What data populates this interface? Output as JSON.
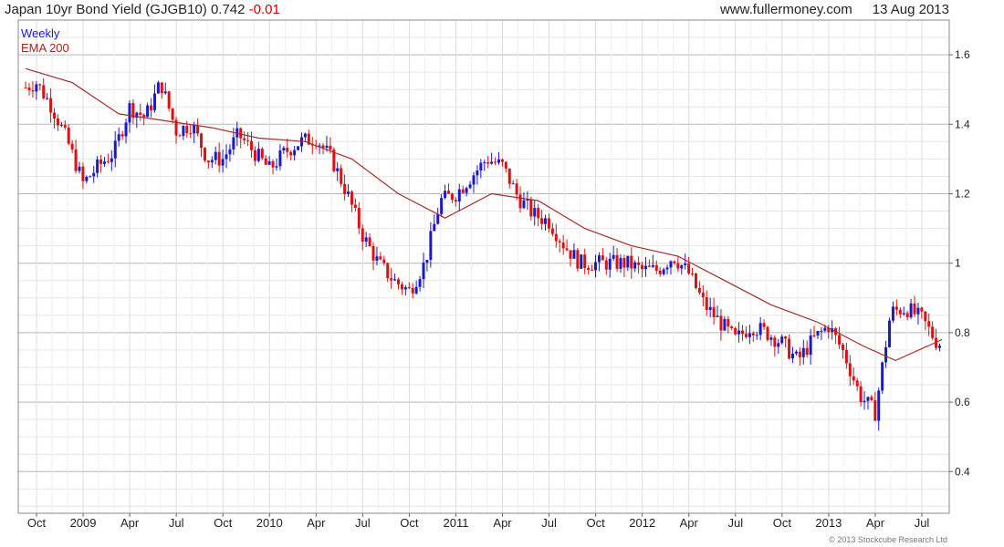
{
  "header": {
    "symbol_title": "Japan 10yr Bond Yield (GJGB10) 0.742",
    "change": "-0.01",
    "site": "www.fullermoney.com",
    "date": "13 Aug 2013"
  },
  "legend": {
    "weekly": "Weekly",
    "ema": "EMA 200"
  },
  "copyright": "© 2013 Stockcube Research Ltd",
  "colors": {
    "up": "#1a1acc",
    "down": "#dd1111",
    "ema": "#a52a2a",
    "grid": "#cccccc"
  },
  "chart_data": {
    "type": "candlestick",
    "yscale": "linear",
    "ylim": [
      0.28,
      1.7
    ],
    "yticks": [
      0.4,
      0.6,
      0.8,
      1,
      1.2,
      1.4,
      1.6
    ],
    "ytick_labels": [
      "0.4",
      "0.6",
      "0.8",
      "1",
      "1.2",
      "1.4",
      "1.6"
    ],
    "xtick_labels": [
      "Oct",
      "2009",
      "Apr",
      "Jul",
      "Oct",
      "2010",
      "Apr",
      "Jul",
      "Oct",
      "2011",
      "Apr",
      "Jul",
      "Oct",
      "2012",
      "Apr",
      "Jul",
      "Oct",
      "2013",
      "Apr",
      "Jul"
    ],
    "grid": true,
    "legend_position": "top-left",
    "series": [
      {
        "name": "Weekly",
        "kind": "close_approx",
        "x": [
          "2008-09",
          "2008-10",
          "2008-11",
          "2008-12",
          "2009-01",
          "2009-02",
          "2009-03",
          "2009-04",
          "2009-05",
          "2009-06",
          "2009-07",
          "2009-08",
          "2009-09",
          "2009-10",
          "2009-11",
          "2009-12",
          "2010-01",
          "2010-02",
          "2010-03",
          "2010-04",
          "2010-05",
          "2010-06",
          "2010-07",
          "2010-08",
          "2010-09",
          "2010-10",
          "2010-11",
          "2010-12",
          "2011-01",
          "2011-02",
          "2011-03",
          "2011-04",
          "2011-05",
          "2011-06",
          "2011-07",
          "2011-08",
          "2011-09",
          "2011-10",
          "2011-11",
          "2011-12",
          "2012-01",
          "2012-02",
          "2012-03",
          "2012-04",
          "2012-05",
          "2012-06",
          "2012-07",
          "2012-08",
          "2012-09",
          "2012-10",
          "2012-11",
          "2012-12",
          "2013-01",
          "2013-02",
          "2013-03",
          "2013-04",
          "2013-05",
          "2013-06",
          "2013-07",
          "2013-08"
        ],
        "values": [
          1.5,
          1.52,
          1.45,
          1.35,
          1.23,
          1.28,
          1.32,
          1.45,
          1.42,
          1.52,
          1.38,
          1.4,
          1.3,
          1.3,
          1.37,
          1.32,
          1.27,
          1.32,
          1.35,
          1.36,
          1.3,
          1.2,
          1.08,
          1.0,
          0.95,
          0.92,
          1.0,
          1.18,
          1.2,
          1.25,
          1.3,
          1.28,
          1.19,
          1.14,
          1.12,
          1.05,
          1.0,
          1.0,
          1.0,
          1.0,
          0.98,
          0.98,
          1.02,
          0.97,
          0.88,
          0.83,
          0.78,
          0.82,
          0.8,
          0.77,
          0.72,
          0.78,
          0.82,
          0.74,
          0.62,
          0.57,
          0.86,
          0.87,
          0.84,
          0.77
        ]
      },
      {
        "name": "EMA 200",
        "kind": "line",
        "x": [
          "2008-09",
          "2008-12",
          "2009-03",
          "2009-06",
          "2009-09",
          "2009-12",
          "2010-03",
          "2010-06",
          "2010-09",
          "2010-12",
          "2011-03",
          "2011-06",
          "2011-09",
          "2011-12",
          "2012-03",
          "2012-06",
          "2012-09",
          "2012-12",
          "2013-03",
          "2013-05",
          "2013-08"
        ],
        "values": [
          1.56,
          1.52,
          1.43,
          1.41,
          1.39,
          1.36,
          1.35,
          1.3,
          1.2,
          1.13,
          1.2,
          1.18,
          1.1,
          1.05,
          1.02,
          0.95,
          0.88,
          0.83,
          0.76,
          0.72,
          0.78
        ]
      }
    ]
  }
}
